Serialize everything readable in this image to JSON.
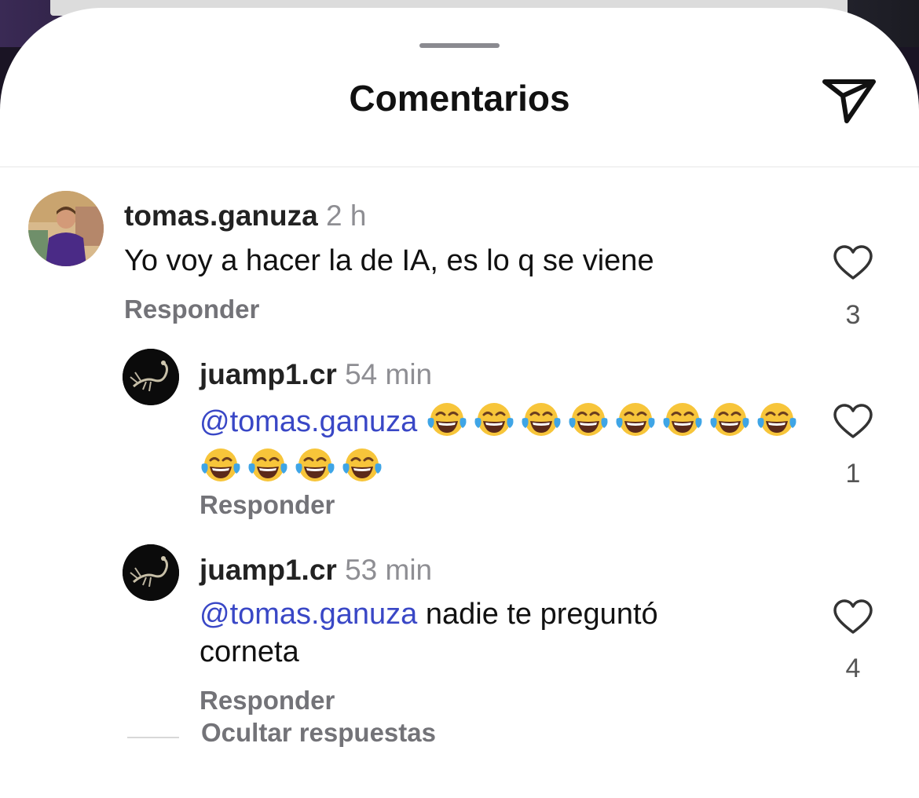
{
  "header": {
    "title": "Comentarios",
    "share_icon": "send-icon"
  },
  "comments": [
    {
      "username": "tomas.ganuza",
      "time": "2 h",
      "text": "Yo voy a hacer la de IA, es lo q se viene",
      "reply_label": "Responder",
      "likes": "3",
      "avatar_badge": "FRANJA MORADA"
    },
    {
      "username": "juamp1.cr",
      "time": "54 min",
      "mention": "@tomas.ganuza",
      "emoji_name": "face-with-tears-of-joy",
      "emoji_count": 12,
      "reply_label": "Responder",
      "likes": "1"
    },
    {
      "username": "juamp1.cr",
      "time": "53 min",
      "mention": "@tomas.ganuza",
      "text_line1": "nadie te preguntó",
      "text_line2": "corneta",
      "reply_label": "Responder",
      "likes": "4"
    }
  ],
  "hide_replies_label": "Ocultar respuestas",
  "colors": {
    "mention": "#3947c6",
    "secondary_text": "#737378",
    "sheet": "#ffffff"
  }
}
